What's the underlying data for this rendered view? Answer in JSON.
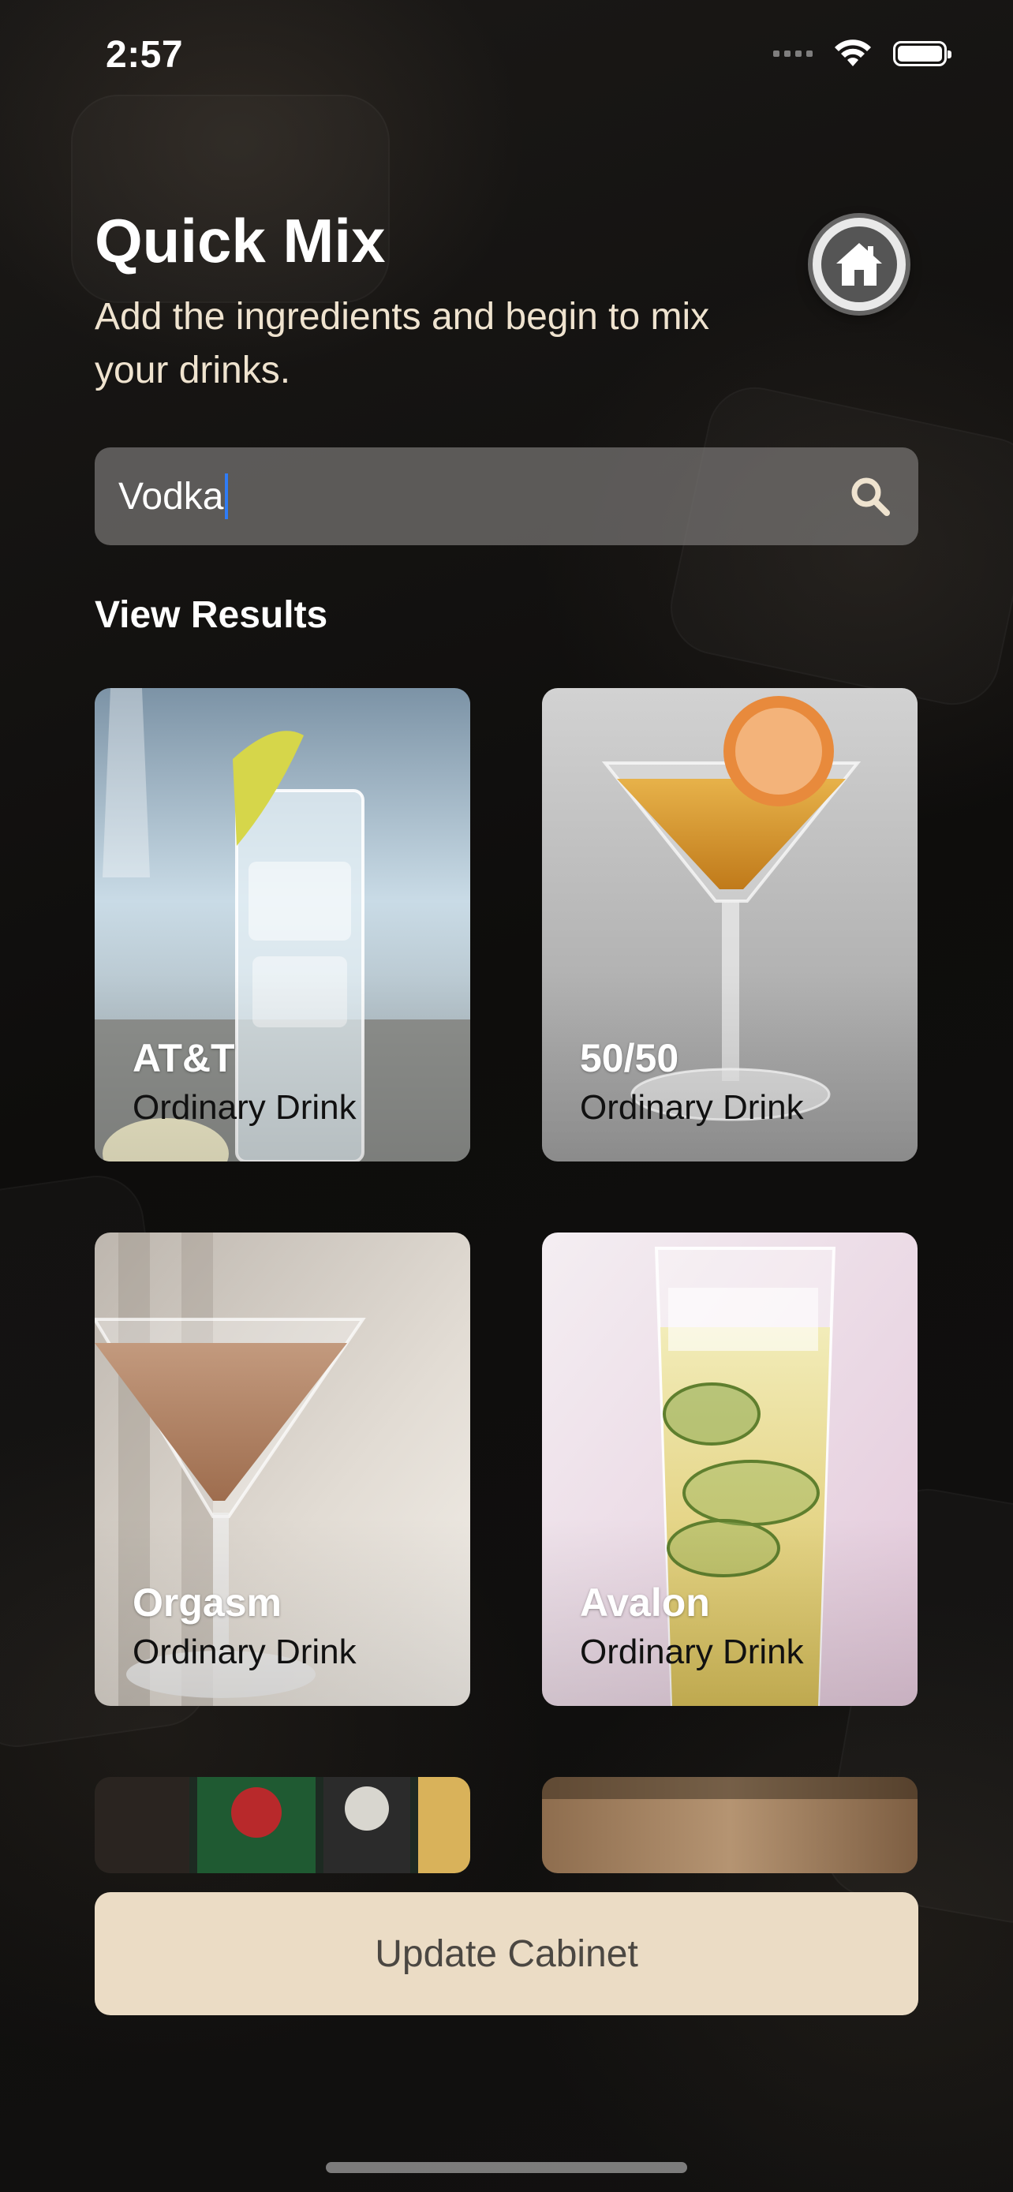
{
  "status_bar": {
    "time": "2:57"
  },
  "header": {
    "title": "Quick Mix",
    "subtitle": "Add the ingredients and begin to mix your drinks."
  },
  "search": {
    "value": "Vodka"
  },
  "results": {
    "label": "View Results",
    "items": [
      {
        "name": "AT&T",
        "category": "Ordinary Drink"
      },
      {
        "name": "50/50",
        "category": "Ordinary Drink"
      },
      {
        "name": "Orgasm",
        "category": "Ordinary Drink"
      },
      {
        "name": "Avalon",
        "category": "Ordinary Drink"
      }
    ]
  },
  "footer": {
    "button_label": "Update Cabinet"
  },
  "icons": {
    "home": "home-icon",
    "search": "search-icon",
    "wifi": "wifi-icon",
    "battery": "battery-icon",
    "signal": "signal-icon"
  },
  "colors": {
    "accent": "#ebdcc5",
    "subtitle": "#efe3cf",
    "caret": "#2f7cf6"
  }
}
